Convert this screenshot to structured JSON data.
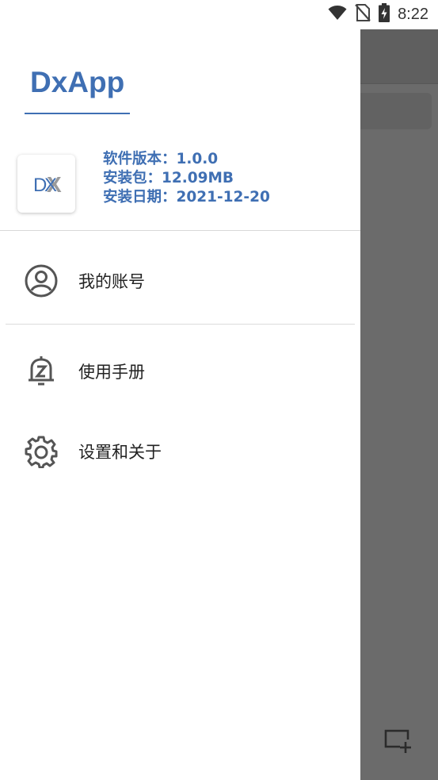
{
  "status_bar": {
    "time": "8:22",
    "icons": [
      "wifi-icon",
      "no-sim-icon",
      "battery-charging-icon"
    ]
  },
  "drawer": {
    "app_name": "DxApp",
    "logo": {
      "text": "DX",
      "colors": {
        "primary": "#3f6fb3",
        "shadow": "#9a9a9a"
      }
    },
    "info": {
      "version": "软件版本：1.0.0",
      "package_size": "安装包：12.09MB",
      "install_date": "安装日期：2021-12-20"
    },
    "menu": [
      {
        "icon": "account-circle-icon",
        "label": "我的账号"
      },
      {
        "icon": "manual-bell-icon",
        "label": "使用手册"
      },
      {
        "icon": "settings-gear-icon",
        "label": "设置和关于"
      }
    ]
  },
  "background_app": {
    "fab_icon": "add-window-icon"
  },
  "colors": {
    "accent": "#3f6fb3",
    "scrim": "#6b6b6b",
    "text": "#222222",
    "icon": "#555555"
  }
}
